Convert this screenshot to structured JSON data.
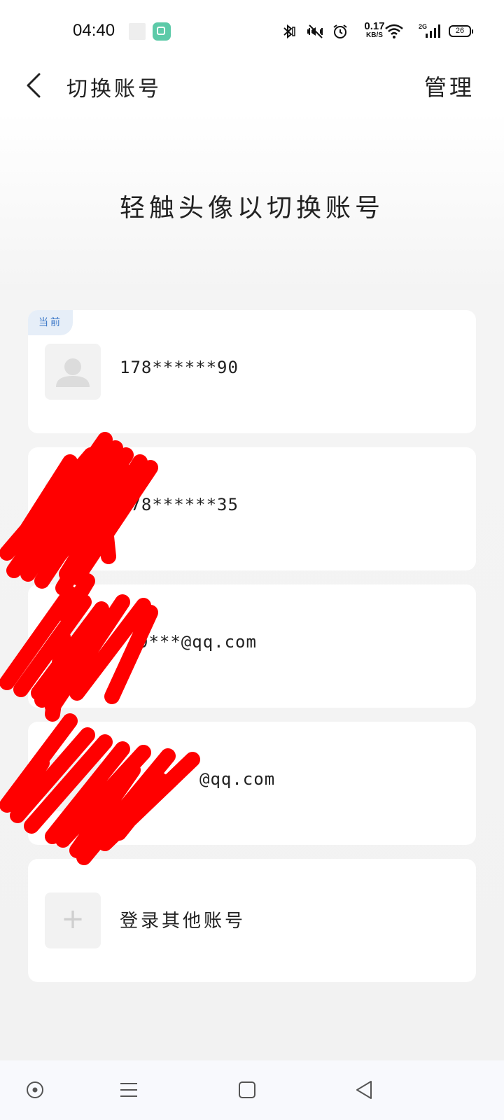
{
  "status_bar": {
    "time": "04:40",
    "net_speed_value": "0.17",
    "net_speed_unit": "KB/S",
    "network_type": "2G",
    "battery": "26",
    "icons": [
      "bluetooth-icon",
      "vibrate-icon",
      "alarm-icon",
      "wifi-icon",
      "signal-icon"
    ]
  },
  "header": {
    "title": "切换账号",
    "manage_label": "管理"
  },
  "hint": "轻触头像以切换账号",
  "accounts": [
    {
      "label": "178******90",
      "badge": "当前"
    },
    {
      "label": "178******35"
    },
    {
      "label": "9***@qq.com"
    },
    {
      "label": "@qq.com"
    }
  ],
  "add_account": {
    "label": "登录其他账号"
  },
  "colors": {
    "accent_badge_text": "#3c78c8",
    "badge_bg": "#e6eef8",
    "redaction": "#ff0000"
  }
}
